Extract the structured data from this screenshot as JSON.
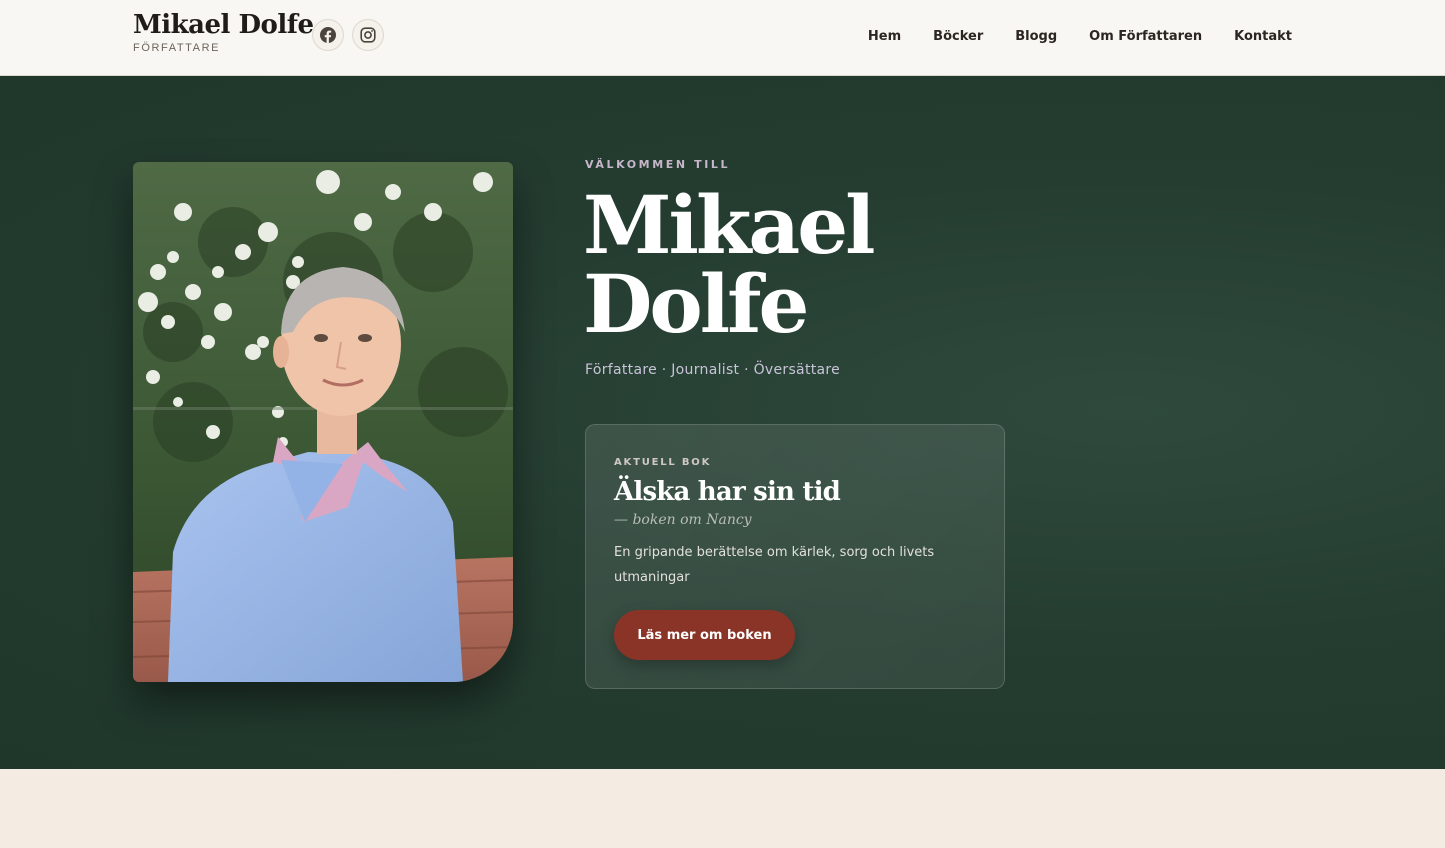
{
  "header": {
    "brand_name": "Mikael Dolfe",
    "brand_subtitle": "FÖRFATTARE",
    "social": [
      {
        "icon": "facebook-icon"
      },
      {
        "icon": "instagram-icon"
      }
    ],
    "nav": [
      "Hem",
      "Böcker",
      "Blogg",
      "Om Författaren",
      "Kontakt"
    ]
  },
  "hero": {
    "welcome": "VÄLKOMMEN TILL",
    "title_line1": "Mikael",
    "title_line2": "Dolfe",
    "roles": "Författare · Journalist · Översättare",
    "book": {
      "kicker": "AKTUELL BOK",
      "title": "Älska har sin tid",
      "subtitle": "— boken om Nancy",
      "description": "En gripande berättelse om kärlek, sorg och livets utmaningar",
      "button": "Läs mer om boken"
    }
  },
  "colors": {
    "hero_bg": "#253d31",
    "accent_button": "#8a3428",
    "header_bg": "#f9f7f3",
    "page_bg": "#f3ebe3"
  }
}
